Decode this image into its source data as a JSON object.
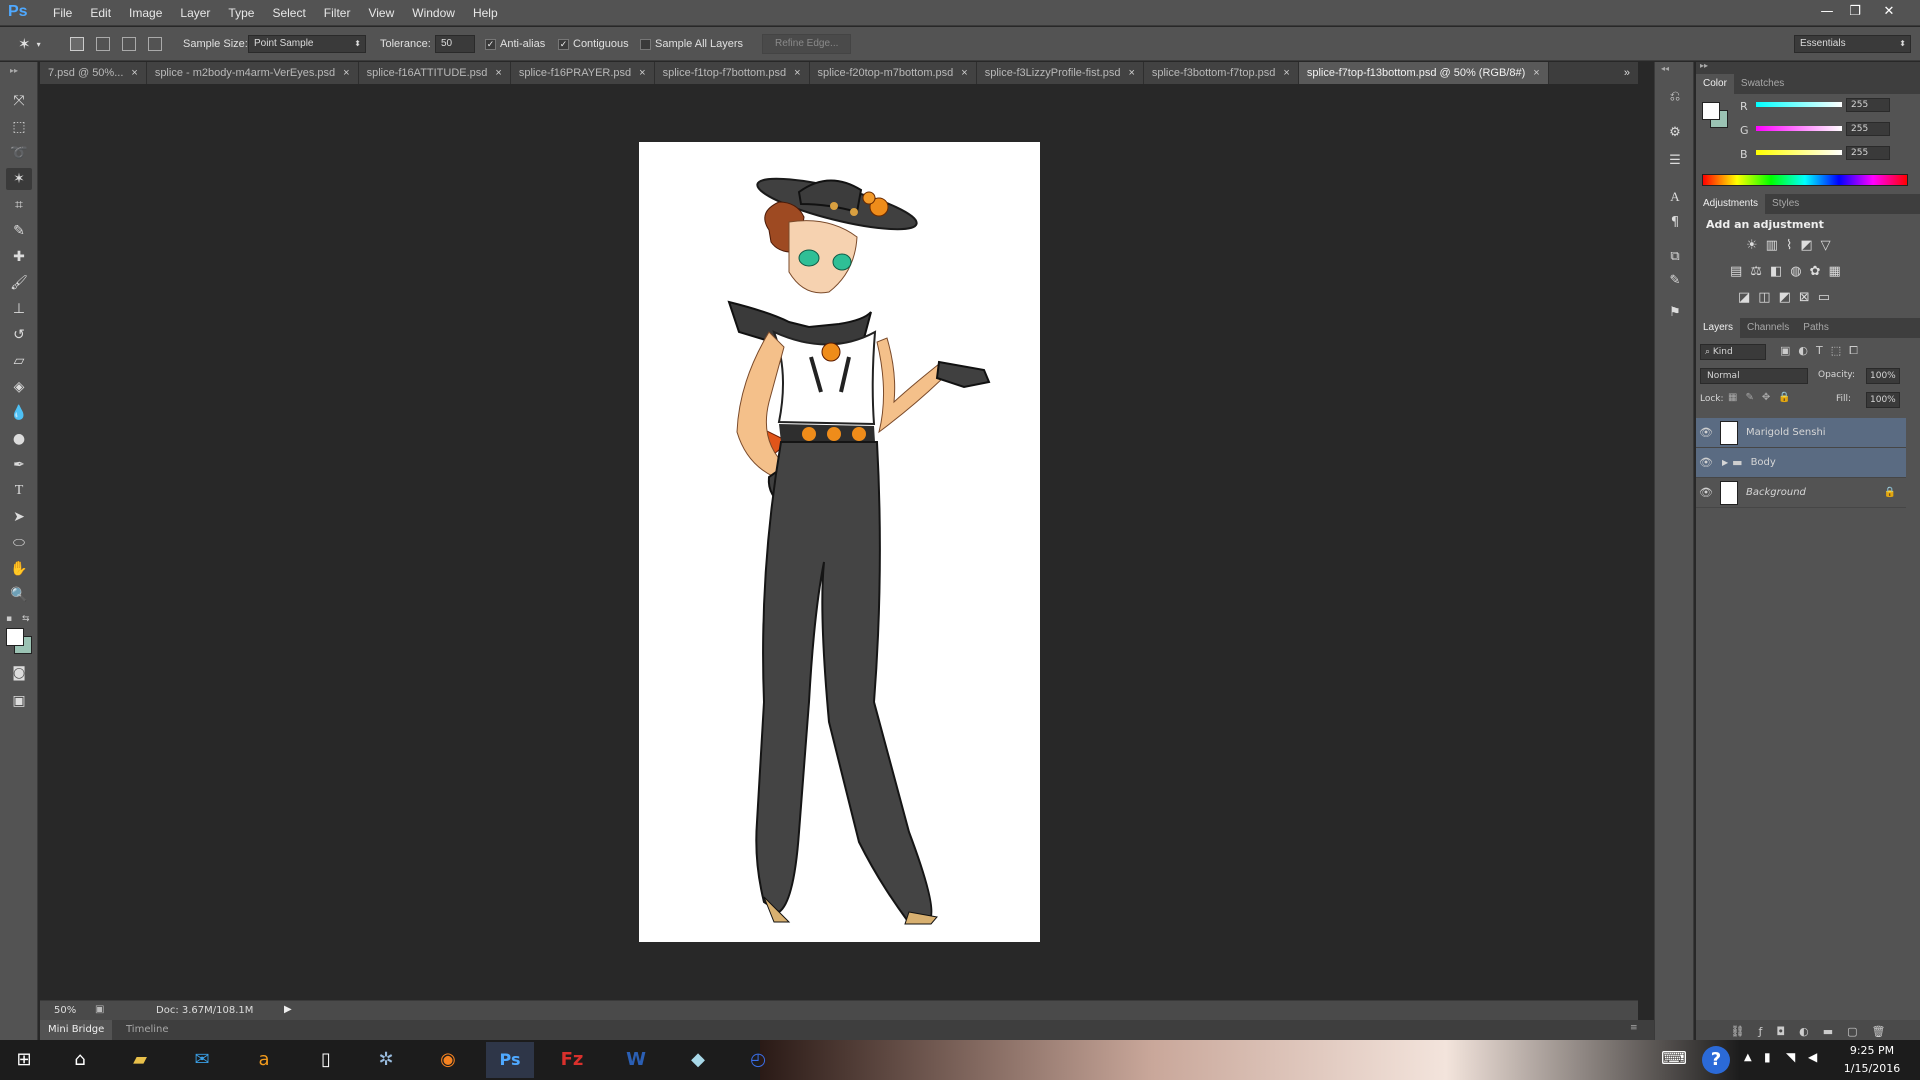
{
  "app": {
    "logo": "Ps",
    "accent": "#4fa9ff"
  },
  "menu": [
    "File",
    "Edit",
    "Image",
    "Layer",
    "Type",
    "Select",
    "Filter",
    "View",
    "Window",
    "Help"
  ],
  "window_controls": [
    "—",
    "❐",
    "✕"
  ],
  "options": {
    "sample_size_label": "Sample Size:",
    "sample_size_value": "Point Sample",
    "tolerance_label": "Tolerance:",
    "tolerance_value": "50",
    "anti_alias": "Anti-alias",
    "contiguous": "Contiguous",
    "sample_all_layers": "Sample All Layers",
    "refine_edge": "Refine Edge...",
    "workspace": "Essentials"
  },
  "tabs": [
    {
      "label": "7.psd @ 50%...",
      "close": "×"
    },
    {
      "label": "splice - m2body-m4arm-VerEyes.psd",
      "close": "×"
    },
    {
      "label": "splice-f16ATTITUDE.psd",
      "close": "×"
    },
    {
      "label": "splice-f16PRAYER.psd",
      "close": "×"
    },
    {
      "label": "splice-f1top-f7bottom.psd",
      "close": "×"
    },
    {
      "label": "splice-f20top-m7bottom.psd",
      "close": "×"
    },
    {
      "label": "splice-f3LizzyProfile-fist.psd",
      "close": "×"
    },
    {
      "label": "splice-f3bottom-f7top.psd",
      "close": "×"
    },
    {
      "label": "splice-f7top-f13bottom.psd @ 50% (RGB/8#)",
      "close": "×"
    }
  ],
  "tabs_overflow": "»",
  "status": {
    "zoom": "50%",
    "doc": "Doc: 3.67M/108.1M"
  },
  "bottom_tabs": [
    "Mini Bridge",
    "Timeline"
  ],
  "color_panel": {
    "tabs": [
      "Color",
      "Swatches"
    ],
    "channels": [
      {
        "label": "R",
        "value": "255",
        "color": "#40e0e0"
      },
      {
        "label": "G",
        "value": "255",
        "color": "#e040e0"
      },
      {
        "label": "B",
        "value": "255",
        "color": "#e0e040"
      }
    ]
  },
  "adjustments_panel": {
    "tabs": [
      "Adjustments",
      "Styles"
    ],
    "title": "Add an adjustment"
  },
  "layers_panel": {
    "tabs": [
      "Layers",
      "Channels",
      "Paths"
    ],
    "kind": "Kind",
    "blend_mode": "Normal",
    "opacity_label": "Opacity:",
    "opacity_value": "100%",
    "lock_label": "Lock:",
    "fill_label": "Fill:",
    "fill_value": "100%",
    "layers": [
      {
        "name": "Marigold Senshi",
        "selected": true
      },
      {
        "name": "Body",
        "selected": true
      },
      {
        "name": "Background",
        "selected": false
      }
    ]
  },
  "taskbar": {
    "time": "9:25 PM",
    "date": "1/15/2016",
    "help": "?"
  }
}
